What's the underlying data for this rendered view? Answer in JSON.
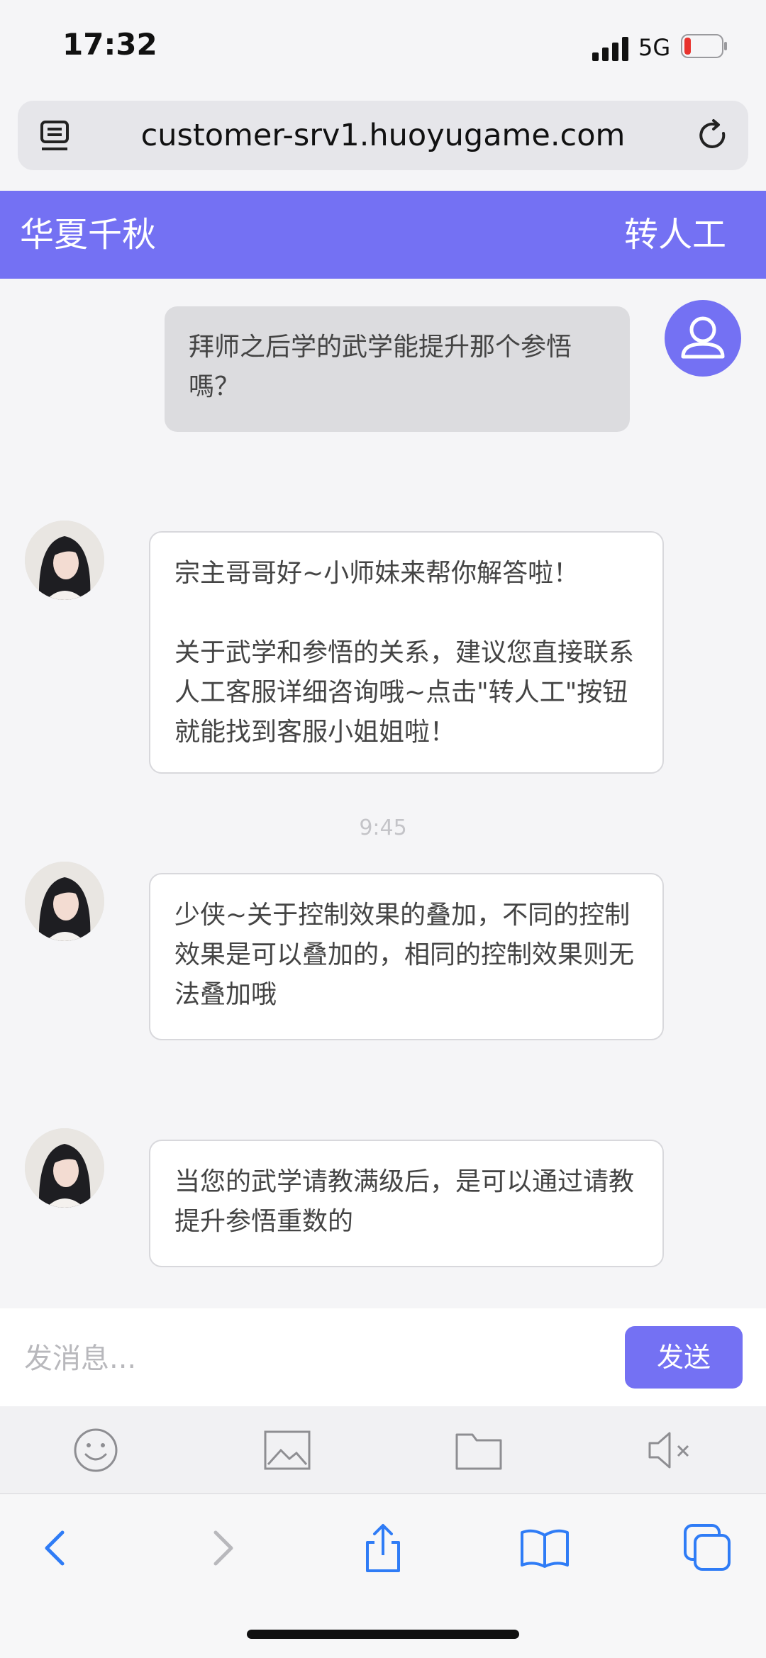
{
  "status_bar": {
    "time": "17:32",
    "network": "5G"
  },
  "browser": {
    "url": "customer-srv1.huoyugame.com"
  },
  "header": {
    "title": "华夏千秋",
    "transfer_label": "转人工"
  },
  "messages": [
    {
      "from": "user",
      "text": "拜师之后学的武学能提升那个参悟嗎？"
    },
    {
      "from": "agent",
      "text": "宗主哥哥好~小师妹来帮你解答啦！\n\n关于武学和参悟的关系，建议您直接联系人工客服详细咨询哦~点击\"转人工\"按钮就能找到客服小姐姐啦！"
    },
    {
      "from": "agent",
      "text": "少侠~关于控制效果的叠加，不同的控制效果是可以叠加的，相同的控制效果则无法叠加哦"
    },
    {
      "from": "agent",
      "text": "当您的武学请教满级后，是可以通过请教提升参悟重数的"
    }
  ],
  "timestamp": "9:45",
  "input": {
    "placeholder": "发消息...",
    "value": "",
    "send_label": "发送"
  },
  "tools": [
    "emoji-icon",
    "image-icon",
    "folder-icon",
    "mute-icon"
  ],
  "colors": {
    "accent": "#7471f3",
    "ios_blue": "#2f7cf6"
  }
}
